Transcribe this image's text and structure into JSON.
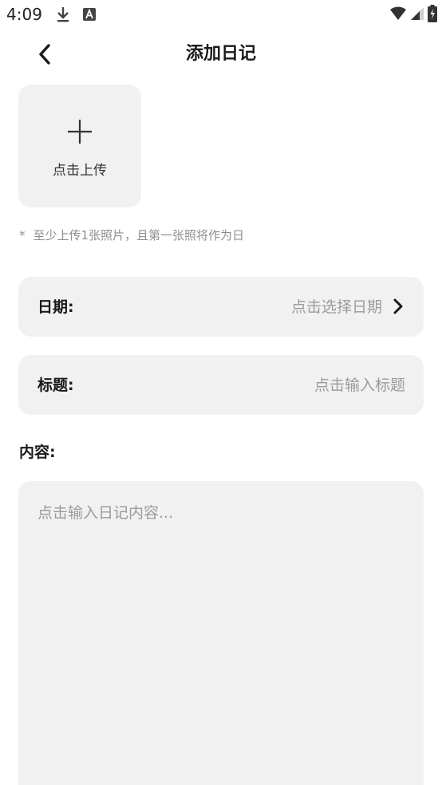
{
  "status_bar": {
    "time": "4:09",
    "left_icons": [
      "download-icon",
      "font-a-icon"
    ],
    "right_icons": [
      "wifi-icon",
      "signal-icon",
      "battery-icon"
    ]
  },
  "header": {
    "title": "添加日记",
    "back_icon": "chevron-left-icon"
  },
  "upload": {
    "label": "点击上传",
    "icon": "plus-icon"
  },
  "hint": {
    "star": "*",
    "text": "至少上传1张照片，且第一张照将作为日"
  },
  "date_field": {
    "label": "日期:",
    "value": "点击选择日期",
    "icon": "chevron-right-icon"
  },
  "title_field": {
    "label": "标题:",
    "placeholder": "点击输入标题"
  },
  "content_field": {
    "label": "内容:",
    "placeholder": "点击输入日记内容..."
  },
  "colors": {
    "background": "#ffffff",
    "field_background": "#f1f1f1",
    "text_primary": "#1a1a1a",
    "text_placeholder": "#9b9b9b",
    "text_hint": "#8e8e8e"
  }
}
